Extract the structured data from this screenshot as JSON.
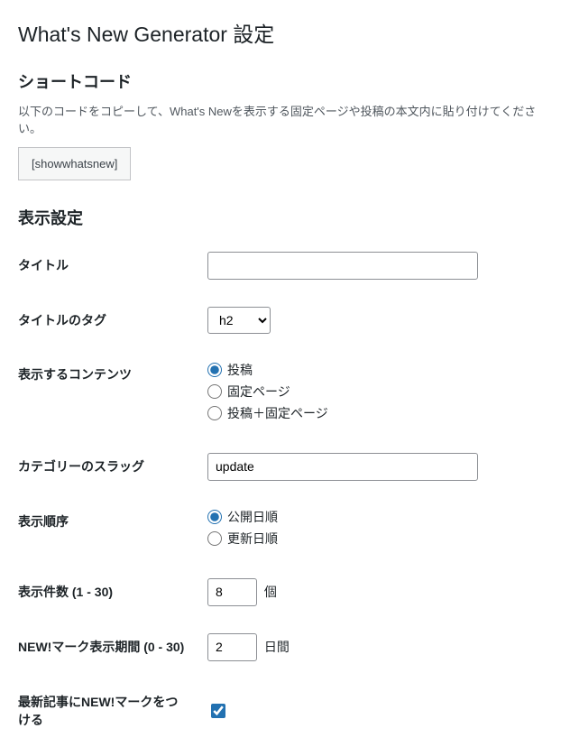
{
  "page_title": "What's New Generator 設定",
  "shortcode_section": {
    "heading": "ショートコード",
    "description": "以下のコードをコピーして、What's Newを表示する固定ページや投稿の本文内に貼り付けてください。",
    "code": "[showwhatsnew]"
  },
  "display_settings": {
    "heading": "表示設定",
    "title": {
      "label": "タイトル",
      "value": ""
    },
    "title_tag": {
      "label": "タイトルのタグ",
      "value": "h2"
    },
    "content_type": {
      "label": "表示するコンテンツ",
      "options": {
        "post": "投稿",
        "page": "固定ページ",
        "both": "投稿＋固定ページ"
      },
      "selected": "post"
    },
    "category_slug": {
      "label": "カテゴリーのスラッグ",
      "value": "update"
    },
    "order": {
      "label": "表示順序",
      "options": {
        "publish": "公開日順",
        "modified": "更新日順"
      },
      "selected": "publish"
    },
    "count": {
      "label": "表示件数 (1 - 30)",
      "value": "8",
      "suffix": "個"
    },
    "new_period": {
      "label": "NEW!マーク表示期間 (0 - 30)",
      "value": "2",
      "suffix": "日間"
    },
    "mark_latest": {
      "label": "最新記事にNEW!マークをつける",
      "checked": true
    }
  }
}
